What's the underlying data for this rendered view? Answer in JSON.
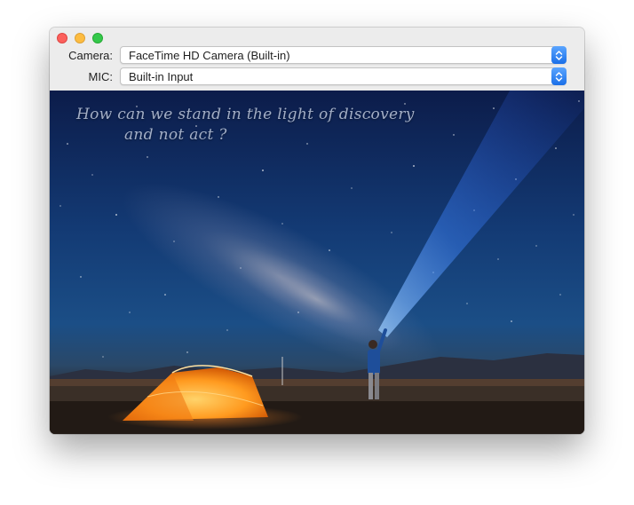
{
  "window": {
    "controls": [
      "close",
      "minimize",
      "zoom"
    ]
  },
  "camera": {
    "label": "Camera:",
    "value": "FaceTime HD Camera (Built-in)"
  },
  "mic": {
    "label": "MIC:",
    "value": "Built-in Input"
  },
  "preview": {
    "quote_line1": "How can we stand in the light of discovery",
    "quote_line2": "and not act ?"
  },
  "colors": {
    "close": "#fc605c",
    "minimize": "#fdbc40",
    "zoom": "#34c84a",
    "accent": "#1a6fe8"
  },
  "icons": [
    "close-icon",
    "minimize-icon",
    "zoom-icon",
    "up-down-chevron-icon"
  ]
}
